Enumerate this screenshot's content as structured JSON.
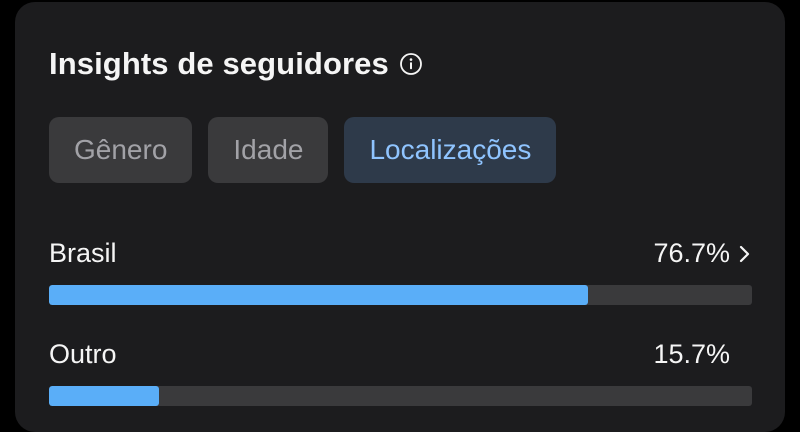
{
  "header": {
    "title": "Insights de seguidores"
  },
  "tabs": [
    {
      "label": "Gênero",
      "active": false
    },
    {
      "label": "Idade",
      "active": false
    },
    {
      "label": "Localizações",
      "active": true
    }
  ],
  "locations": [
    {
      "name": "Brasil",
      "value_text": "76.7%",
      "fraction": 0.767,
      "has_chevron": true
    },
    {
      "name": "Outro",
      "value_text": "15.7%",
      "fraction": 0.157,
      "has_chevron": false
    }
  ],
  "colors": {
    "bar_fill": "#5aaef8",
    "bar_track": "#3a3a3c",
    "active_tab_text": "#8fc4ff"
  }
}
